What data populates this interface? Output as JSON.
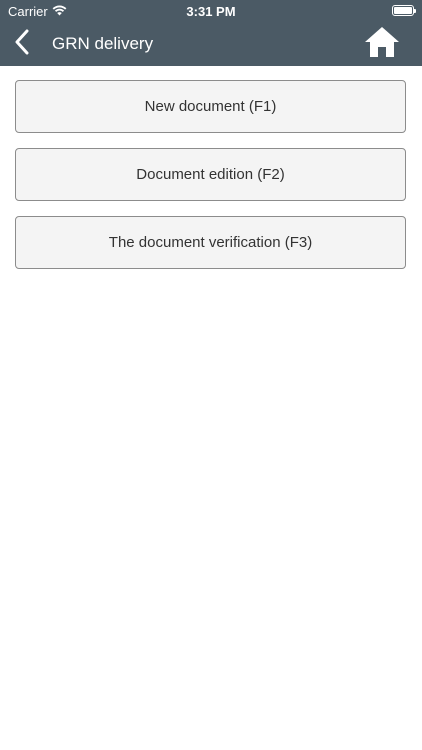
{
  "status_bar": {
    "carrier": "Carrier",
    "time": "3:31 PM",
    "wifi_icon": "wifi-icon",
    "battery_icon": "battery-icon"
  },
  "nav_bar": {
    "title": "GRN delivery",
    "back_icon": "chevron-left-icon",
    "home_icon": "home-icon"
  },
  "menu": {
    "items": [
      {
        "label": "New document (F1)"
      },
      {
        "label": "Document edition (F2)"
      },
      {
        "label": "The document verification (F3)"
      }
    ]
  },
  "colors": {
    "header_bg": "#4b5a65",
    "button_bg": "#f4f4f4",
    "button_border": "#8c8c8c",
    "button_text": "#333333"
  }
}
